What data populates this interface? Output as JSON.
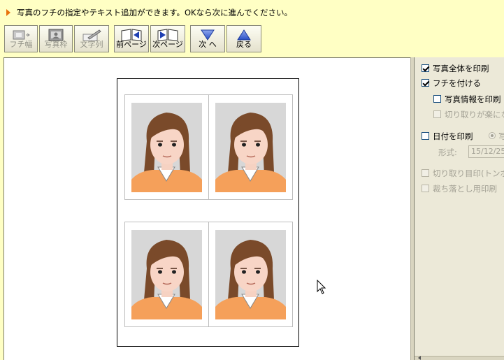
{
  "instruction": {
    "text": "写真のフチの指定やテキスト追加ができます。OKなら次に進んでください。"
  },
  "toolbar": {
    "border_width": "フチ幅",
    "photo_frame": "写真枠",
    "text_column": "文字列",
    "prev_page": "前ページ",
    "next_page": "次ページ",
    "next": "次 へ",
    "back": "戻る"
  },
  "sheet": {
    "photo_count": 4
  },
  "options": {
    "print_whole_photo": {
      "label": "写真全体を印刷",
      "checked": true
    },
    "add_border": {
      "label": "フチを付ける",
      "checked": true
    },
    "print_photo_info": {
      "label": "写真情報を印刷",
      "checked": false
    },
    "easy_cut": {
      "label": "切り取りが楽にな",
      "checked": false
    },
    "print_date": {
      "label": "日付を印刷",
      "checked": false
    },
    "date_radio": {
      "label": "写"
    },
    "format_label": "形式:",
    "format_value": "15/12/25",
    "cut_marks": {
      "label": "切り取り目印(トンボ)",
      "checked": false
    },
    "bleed_print": {
      "label": "裁ち落とし用印刷",
      "checked": false
    }
  },
  "colors": {
    "background": "#ffffc4",
    "panel": "#ece9d8",
    "accent_arrow": "#e8730c",
    "nav_blue": "#3a62c9"
  }
}
